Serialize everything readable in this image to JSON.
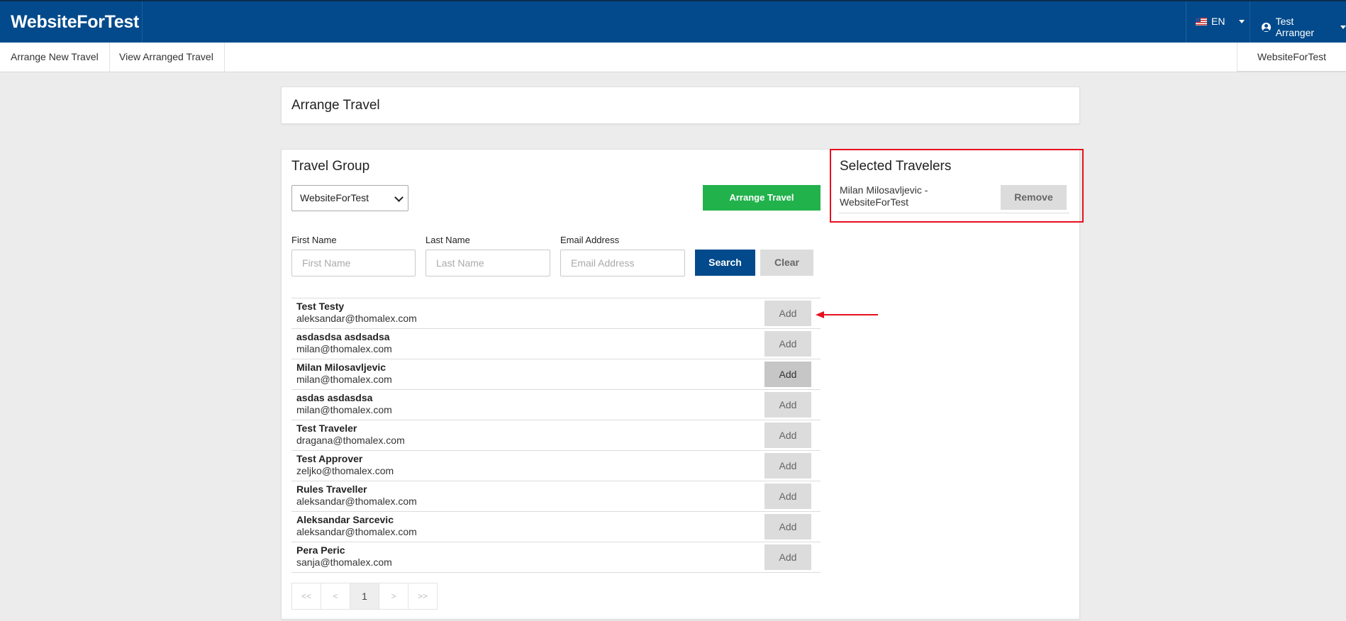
{
  "header": {
    "brand": "WebsiteForTest",
    "language": "EN",
    "user": "Test Arranger"
  },
  "subnav": {
    "items": [
      "Arrange New Travel",
      "View Arranged Travel"
    ],
    "organization": "WebsiteForTest"
  },
  "arrange_card": {
    "title": "Arrange Travel"
  },
  "travel_group": {
    "title": "Travel Group",
    "selected_group": "WebsiteForTest",
    "arrange_button": "Arrange Travel",
    "filters": {
      "first_name": {
        "label": "First Name",
        "placeholder": "First Name"
      },
      "last_name": {
        "label": "Last Name",
        "placeholder": "Last Name"
      },
      "email": {
        "label": "Email Address",
        "placeholder": "Email Address"
      },
      "search_button": "Search",
      "clear_button": "Clear"
    },
    "add_label": "Add",
    "travelers": [
      {
        "name": "Test Testy",
        "email": "aleksandar@thomalex.com"
      },
      {
        "name": "asdasdsa asdsadsa",
        "email": "milan@thomalex.com"
      },
      {
        "name": "Milan Milosavljevic",
        "email": "milan@thomalex.com"
      },
      {
        "name": "asdas asdasdsa",
        "email": "milan@thomalex.com"
      },
      {
        "name": "Test Traveler",
        "email": "dragana@thomalex.com"
      },
      {
        "name": "Test Approver",
        "email": "zeljko@thomalex.com"
      },
      {
        "name": "Rules Traveller",
        "email": "aleksandar@thomalex.com"
      },
      {
        "name": "Aleksandar Sarcevic",
        "email": "aleksandar@thomalex.com"
      },
      {
        "name": "Pera Peric",
        "email": "sanja@thomalex.com"
      }
    ],
    "pagination": {
      "first": "<<",
      "prev": "<",
      "current": "1",
      "next": ">",
      "last": ">>"
    }
  },
  "selected_travelers": {
    "title": "Selected Travelers",
    "items": [
      {
        "line1": "Milan Milosavljevic -",
        "line2": "WebsiteForTest"
      }
    ],
    "remove_label": "Remove"
  },
  "colors": {
    "header_bg": "#024a8b",
    "green": "#22b24c",
    "highlight_red": "#e8101e",
    "page_bg": "#ececec"
  }
}
